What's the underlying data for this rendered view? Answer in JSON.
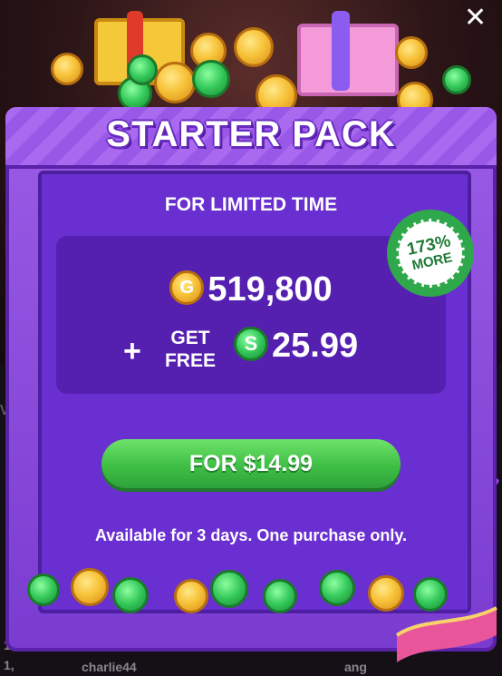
{
  "popup": {
    "title": "STARTER PACK",
    "subtitle": "FOR LIMITED TIME",
    "coins_amount": "519,800",
    "coin_symbol": "G",
    "plus_sign": "+",
    "get_free": "GET FREE",
    "cash_amount": "25.99",
    "cash_symbol": "S",
    "badge_percent": "173%",
    "badge_more": "MORE",
    "buy_label": "FOR $14.99",
    "note": "Available for 3 days. One purchase only.",
    "close_symbol": "✕"
  },
  "background": {
    "side_text": "ve",
    "names": [
      "charlie44",
      "ang"
    ],
    "side_numbers": [
      "1",
      "1,"
    ]
  },
  "colors": {
    "panel": "#7a3cd0",
    "offer_box": "#5520b0",
    "buy_button": "#3fbf45",
    "badge": "#2ea84a",
    "coin_gold": "#f7c33a",
    "coin_green": "#34c85a"
  }
}
